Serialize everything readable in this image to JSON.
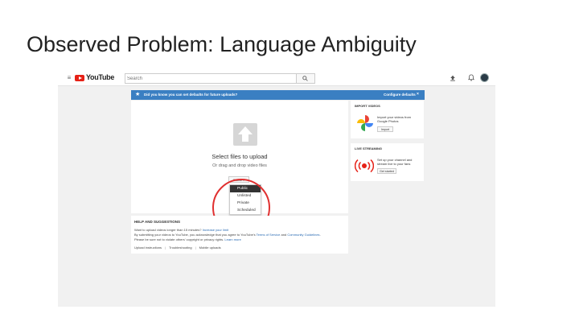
{
  "slide": {
    "title": "Observed Problem: Language Ambiguity"
  },
  "youtube": {
    "header": {
      "menu_glyph": "≡",
      "logo_text": "YouTube",
      "search_placeholder": "Search",
      "icons": [
        "menu-icon",
        "search-icon",
        "upload-icon",
        "bell-icon",
        "avatar"
      ]
    },
    "banner": {
      "text": "Did you know you can set defaults for future uploads?",
      "link": "Configure defaults",
      "close": "×",
      "color": "#3a7fc2"
    },
    "upload": {
      "select_text": "Select files to upload",
      "drag_text": "Or drag and drop video files",
      "privacy_value": "Public ▾",
      "options": [
        "Public",
        "Unlisted",
        "Private",
        "Scheduled"
      ],
      "selected_option": "Public",
      "highlight_color": "#e03030"
    },
    "help": {
      "title": "HELP AND SUGGESTIONS",
      "line1_text": "Want to upload videos longer than 15 minutes? ",
      "line1_link": "Increase your limit",
      "line2_text": "By submitting your videos to YouTube, you acknowledge that you agree to YouTube's ",
      "line2_link1": "Terms of Service",
      "line2_mid": " and ",
      "line2_link2": "Community Guidelines",
      "line2_end": ".",
      "line3_text": "Please be sure not to violate others' copyright or privacy rights. ",
      "line3_link": "Learn more",
      "links": [
        "Upload instructions",
        "Troubleshooting",
        "Mobile uploads"
      ],
      "separator": "|"
    },
    "import": {
      "title": "IMPORT VIDEOS",
      "text": "Import your videos from Google Photos",
      "button": "Import"
    },
    "live": {
      "title": "LIVE STREAMING",
      "text": "Set up your channel and stream live to your fans",
      "button": "Get started"
    }
  }
}
